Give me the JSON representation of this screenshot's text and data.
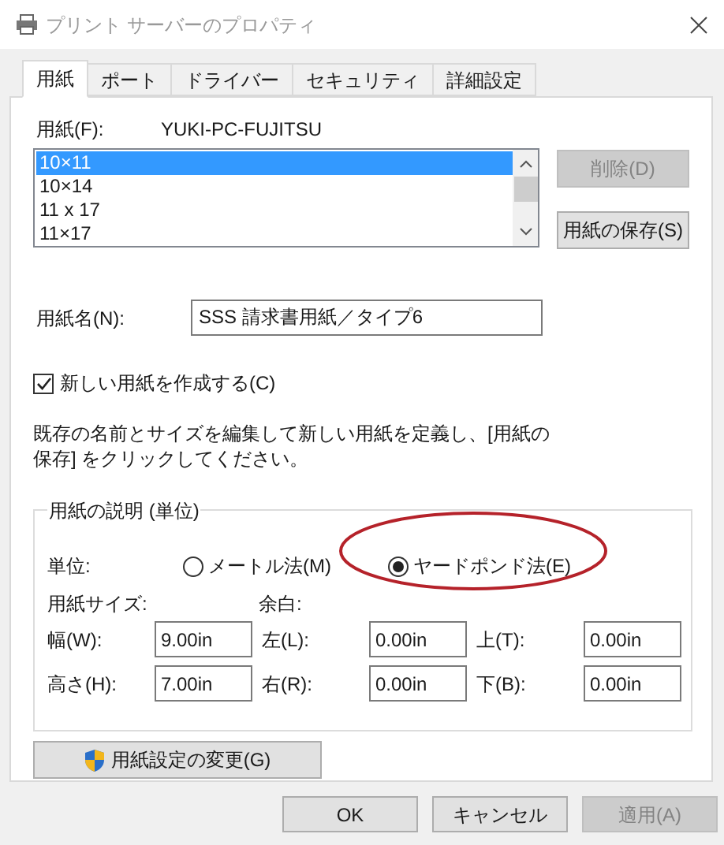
{
  "window": {
    "title": "プリント サーバーのプロパティ"
  },
  "tabs": [
    {
      "label": "用紙",
      "selected": true
    },
    {
      "label": "ポート",
      "selected": false
    },
    {
      "label": "ドライバー",
      "selected": false
    },
    {
      "label": "セキュリティ",
      "selected": false
    },
    {
      "label": "詳細設定",
      "selected": false
    }
  ],
  "forms_label": "用紙(F):",
  "server_name": "YUKI-PC-FUJITSU",
  "forms_list": [
    {
      "label": "10×11",
      "selected": true
    },
    {
      "label": "10×14",
      "selected": false
    },
    {
      "label": "11 x 17",
      "selected": false
    },
    {
      "label": "11×17",
      "selected": false
    }
  ],
  "side_buttons": [
    {
      "label": "削除(D)",
      "disabled": true
    },
    {
      "label": "用紙の保存(S)",
      "disabled": false
    }
  ],
  "form_name": {
    "label": "用紙名(N):",
    "value": "SSS 請求書用紙／タイプ6"
  },
  "create_new": {
    "label": "新しい用紙を作成する(C)",
    "checked": true
  },
  "instructions": "既存の名前とサイズを編集して新しい用紙を定義し、[用紙の保存] をクリックしてください。",
  "description_group": {
    "title": "用紙の説明 (単位)",
    "units_label": "単位:",
    "units": [
      {
        "label": "メートル法(M)",
        "selected": false
      },
      {
        "label": "ヤードポンド法(E)",
        "selected": true
      }
    ],
    "size_label": "用紙サイズ:",
    "margins_label": "余白:",
    "rows": [
      [
        {
          "label": "幅(W):",
          "value": "9.00in"
        },
        {
          "label": "左(L):",
          "value": "0.00in"
        },
        {
          "label": "上(T):",
          "value": "0.00in"
        }
      ],
      [
        {
          "label": "高さ(H):",
          "value": "7.00in"
        },
        {
          "label": "右(R):",
          "value": "0.00in"
        },
        {
          "label": "下(B):",
          "value": "0.00in"
        }
      ]
    ]
  },
  "change_settings_button": {
    "label": "用紙設定の変更(G)"
  },
  "dialog_buttons": [
    {
      "label": "OK",
      "disabled": false
    },
    {
      "label": "キャンセル",
      "disabled": false
    },
    {
      "label": "適用(A)",
      "disabled": true
    }
  ]
}
